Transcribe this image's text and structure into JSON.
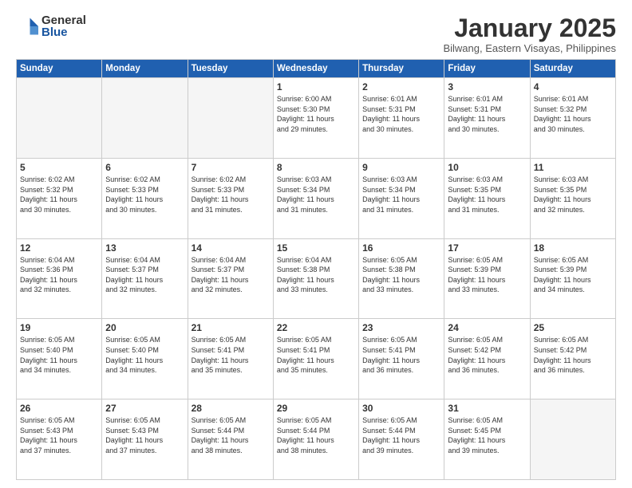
{
  "logo": {
    "general": "General",
    "blue": "Blue"
  },
  "header": {
    "month": "January 2025",
    "location": "Bilwang, Eastern Visayas, Philippines"
  },
  "days_of_week": [
    "Sunday",
    "Monday",
    "Tuesday",
    "Wednesday",
    "Thursday",
    "Friday",
    "Saturday"
  ],
  "weeks": [
    [
      {
        "day": "",
        "info": ""
      },
      {
        "day": "",
        "info": ""
      },
      {
        "day": "",
        "info": ""
      },
      {
        "day": "1",
        "info": "Sunrise: 6:00 AM\nSunset: 5:30 PM\nDaylight: 11 hours\nand 29 minutes."
      },
      {
        "day": "2",
        "info": "Sunrise: 6:01 AM\nSunset: 5:31 PM\nDaylight: 11 hours\nand 30 minutes."
      },
      {
        "day": "3",
        "info": "Sunrise: 6:01 AM\nSunset: 5:31 PM\nDaylight: 11 hours\nand 30 minutes."
      },
      {
        "day": "4",
        "info": "Sunrise: 6:01 AM\nSunset: 5:32 PM\nDaylight: 11 hours\nand 30 minutes."
      }
    ],
    [
      {
        "day": "5",
        "info": "Sunrise: 6:02 AM\nSunset: 5:32 PM\nDaylight: 11 hours\nand 30 minutes."
      },
      {
        "day": "6",
        "info": "Sunrise: 6:02 AM\nSunset: 5:33 PM\nDaylight: 11 hours\nand 30 minutes."
      },
      {
        "day": "7",
        "info": "Sunrise: 6:02 AM\nSunset: 5:33 PM\nDaylight: 11 hours\nand 31 minutes."
      },
      {
        "day": "8",
        "info": "Sunrise: 6:03 AM\nSunset: 5:34 PM\nDaylight: 11 hours\nand 31 minutes."
      },
      {
        "day": "9",
        "info": "Sunrise: 6:03 AM\nSunset: 5:34 PM\nDaylight: 11 hours\nand 31 minutes."
      },
      {
        "day": "10",
        "info": "Sunrise: 6:03 AM\nSunset: 5:35 PM\nDaylight: 11 hours\nand 31 minutes."
      },
      {
        "day": "11",
        "info": "Sunrise: 6:03 AM\nSunset: 5:35 PM\nDaylight: 11 hours\nand 32 minutes."
      }
    ],
    [
      {
        "day": "12",
        "info": "Sunrise: 6:04 AM\nSunset: 5:36 PM\nDaylight: 11 hours\nand 32 minutes."
      },
      {
        "day": "13",
        "info": "Sunrise: 6:04 AM\nSunset: 5:37 PM\nDaylight: 11 hours\nand 32 minutes."
      },
      {
        "day": "14",
        "info": "Sunrise: 6:04 AM\nSunset: 5:37 PM\nDaylight: 11 hours\nand 32 minutes."
      },
      {
        "day": "15",
        "info": "Sunrise: 6:04 AM\nSunset: 5:38 PM\nDaylight: 11 hours\nand 33 minutes."
      },
      {
        "day": "16",
        "info": "Sunrise: 6:05 AM\nSunset: 5:38 PM\nDaylight: 11 hours\nand 33 minutes."
      },
      {
        "day": "17",
        "info": "Sunrise: 6:05 AM\nSunset: 5:39 PM\nDaylight: 11 hours\nand 33 minutes."
      },
      {
        "day": "18",
        "info": "Sunrise: 6:05 AM\nSunset: 5:39 PM\nDaylight: 11 hours\nand 34 minutes."
      }
    ],
    [
      {
        "day": "19",
        "info": "Sunrise: 6:05 AM\nSunset: 5:40 PM\nDaylight: 11 hours\nand 34 minutes."
      },
      {
        "day": "20",
        "info": "Sunrise: 6:05 AM\nSunset: 5:40 PM\nDaylight: 11 hours\nand 34 minutes."
      },
      {
        "day": "21",
        "info": "Sunrise: 6:05 AM\nSunset: 5:41 PM\nDaylight: 11 hours\nand 35 minutes."
      },
      {
        "day": "22",
        "info": "Sunrise: 6:05 AM\nSunset: 5:41 PM\nDaylight: 11 hours\nand 35 minutes."
      },
      {
        "day": "23",
        "info": "Sunrise: 6:05 AM\nSunset: 5:41 PM\nDaylight: 11 hours\nand 36 minutes."
      },
      {
        "day": "24",
        "info": "Sunrise: 6:05 AM\nSunset: 5:42 PM\nDaylight: 11 hours\nand 36 minutes."
      },
      {
        "day": "25",
        "info": "Sunrise: 6:05 AM\nSunset: 5:42 PM\nDaylight: 11 hours\nand 36 minutes."
      }
    ],
    [
      {
        "day": "26",
        "info": "Sunrise: 6:05 AM\nSunset: 5:43 PM\nDaylight: 11 hours\nand 37 minutes."
      },
      {
        "day": "27",
        "info": "Sunrise: 6:05 AM\nSunset: 5:43 PM\nDaylight: 11 hours\nand 37 minutes."
      },
      {
        "day": "28",
        "info": "Sunrise: 6:05 AM\nSunset: 5:44 PM\nDaylight: 11 hours\nand 38 minutes."
      },
      {
        "day": "29",
        "info": "Sunrise: 6:05 AM\nSunset: 5:44 PM\nDaylight: 11 hours\nand 38 minutes."
      },
      {
        "day": "30",
        "info": "Sunrise: 6:05 AM\nSunset: 5:44 PM\nDaylight: 11 hours\nand 39 minutes."
      },
      {
        "day": "31",
        "info": "Sunrise: 6:05 AM\nSunset: 5:45 PM\nDaylight: 11 hours\nand 39 minutes."
      },
      {
        "day": "",
        "info": ""
      }
    ]
  ]
}
